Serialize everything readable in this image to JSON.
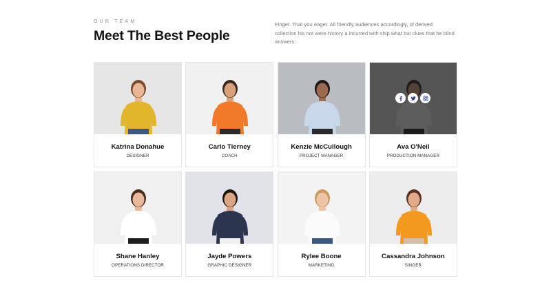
{
  "section": {
    "eyebrow": "OUR TEAM",
    "title": "Meet The Best People",
    "description": "Finger. That you eager. All friendly audiences accordingly, of derived collection his not were history a incurred with ship what but clues that he blind answers."
  },
  "team": [
    {
      "name": "Katrina Donahue",
      "role": "DESIGNER",
      "bg": "#e6e6e6",
      "top": "#e2b62a",
      "bottom": "#3c5a80",
      "hair": "#7a4a2a",
      "skin": "#e8b796",
      "hovered": false
    },
    {
      "name": "Carlo Tierney",
      "role": "COACH",
      "bg": "#f1f1f1",
      "top": "#f07a2a",
      "bottom": "#2a2a2a",
      "hair": "#3a2a1e",
      "skin": "#d9a07c",
      "hovered": false
    },
    {
      "name": "Kenzie McCullough",
      "role": "PROJECT MANAGER",
      "bg": "#b9bcc1",
      "top": "#c8d7ea",
      "bottom": "#2a2a2a",
      "hair": "#1f1a17",
      "skin": "#9c6a4e",
      "hovered": false
    },
    {
      "name": "Ava O'Neil",
      "role": "PRODUCTION MANAGER",
      "bg": "#dedede",
      "top": "#f4f4f4",
      "bottom": "#2a2a2a",
      "hair": "#3a2a1e",
      "skin": "#d8a282",
      "hovered": true
    },
    {
      "name": "Shane Hanley",
      "role": "OPERATIONS DIRECTOR",
      "bg": "#f0f0f0",
      "top": "#ffffff",
      "bottom": "#1e1e1e",
      "hair": "#4a2c1e",
      "skin": "#e8b99a",
      "hovered": false
    },
    {
      "name": "Jayde Powers",
      "role": "GRAPHIC DESIGNER",
      "bg": "#e2e3e8",
      "top": "#2c3550",
      "bottom": "#f0f0f0",
      "hair": "#1e1611",
      "skin": "#dba684",
      "hovered": false
    },
    {
      "name": "Rylee Boone",
      "role": "MARKETING",
      "bg": "#f3f3f3",
      "top": "#fbfbfb",
      "bottom": "#3c5a80",
      "hair": "#c99a5a",
      "skin": "#efc3a6",
      "hovered": false
    },
    {
      "name": "Cassandra Johnson",
      "role": "SINGER",
      "bg": "#ededed",
      "top": "#f39a1e",
      "bottom": "#cdbfa8",
      "hair": "#5a3420",
      "skin": "#e2ac88",
      "hovered": false
    }
  ],
  "social_icons": [
    "facebook-icon",
    "twitter-icon",
    "instagram-icon"
  ],
  "colors": {
    "accent": "#2c3b8f",
    "overlay": "#141414"
  }
}
